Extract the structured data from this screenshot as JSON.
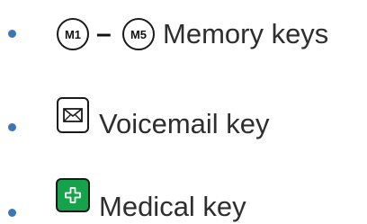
{
  "items": [
    {
      "key_icons": [
        "M1",
        "M5"
      ],
      "separator": "–",
      "label": "Memory keys"
    },
    {
      "key_icon": "envelope-icon",
      "label": "Voicemail key"
    },
    {
      "key_icon": "medical-cross-icon",
      "label": "Medical key"
    }
  ],
  "colors": {
    "bullet": "#3a78b4",
    "text": "#2e2e2e",
    "medical_key_bg": "#16a24a",
    "key_border": "#1a1a1a"
  }
}
